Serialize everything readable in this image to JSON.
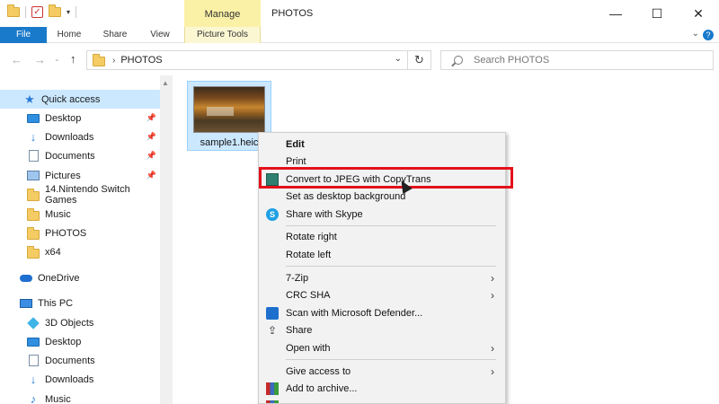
{
  "window": {
    "title": "PHOTOS",
    "context_group": "Manage",
    "controls": [
      "—",
      "☐",
      "✕"
    ]
  },
  "ribbon": {
    "tabs": [
      "File",
      "Home",
      "Share",
      "View",
      "Picture Tools"
    ]
  },
  "address": {
    "path": "PHOTOS",
    "search_placeholder": "Search PHOTOS"
  },
  "nav": {
    "items": [
      {
        "label": "Quick access",
        "icon": "star-icon",
        "pinned": false
      },
      {
        "label": "Desktop",
        "icon": "desktop-icon",
        "pinned": true
      },
      {
        "label": "Downloads",
        "icon": "downloads-icon",
        "pinned": true
      },
      {
        "label": "Documents",
        "icon": "documents-icon",
        "pinned": true
      },
      {
        "label": "Pictures",
        "icon": "pictures-icon",
        "pinned": true
      },
      {
        "label": "14.Nintendo Switch Games",
        "icon": "folder-icon",
        "pinned": false
      },
      {
        "label": "Music",
        "icon": "folder-icon",
        "pinned": false
      },
      {
        "label": "PHOTOS",
        "icon": "folder-icon",
        "pinned": false
      },
      {
        "label": "x64",
        "icon": "folder-icon",
        "pinned": false
      },
      {
        "label": "OneDrive",
        "icon": "onedrive-icon",
        "pinned": false
      },
      {
        "label": "This PC",
        "icon": "pc-icon",
        "pinned": false
      },
      {
        "label": "3D Objects",
        "icon": "3d-objects-icon",
        "pinned": false
      },
      {
        "label": "Desktop",
        "icon": "desktop-icon",
        "pinned": false
      },
      {
        "label": "Documents",
        "icon": "documents-icon",
        "pinned": false
      },
      {
        "label": "Downloads",
        "icon": "downloads-icon",
        "pinned": false
      },
      {
        "label": "Music",
        "icon": "music-icon",
        "pinned": false
      }
    ]
  },
  "file": {
    "name": "sample1.heic"
  },
  "context_menu": {
    "items": [
      {
        "label": "Edit",
        "bold": true
      },
      {
        "label": "Print"
      },
      {
        "label": "Convert to JPEG with CopyTrans",
        "icon": "copytrans-icon",
        "highlighted": true
      },
      {
        "label": "Set as desktop background"
      },
      {
        "label": "Share with Skype",
        "icon": "skype-icon"
      },
      {
        "label": "Rotate right"
      },
      {
        "label": "Rotate left"
      },
      {
        "label": "7-Zip",
        "submenu": true
      },
      {
        "label": "CRC SHA",
        "submenu": true
      },
      {
        "label": "Scan with Microsoft Defender...",
        "icon": "defender-icon"
      },
      {
        "label": "Share",
        "icon": "share-icon"
      },
      {
        "label": "Open with",
        "submenu": true
      },
      {
        "label": "Give access to",
        "submenu": true
      },
      {
        "label": "Add to archive...",
        "icon": "winrar-icon"
      }
    ]
  },
  "colors": {
    "accent": "#1979ca",
    "selection": "#cce8ff",
    "highlight_box": "#e4101a",
    "manage_bg": "#fbf1a6"
  }
}
